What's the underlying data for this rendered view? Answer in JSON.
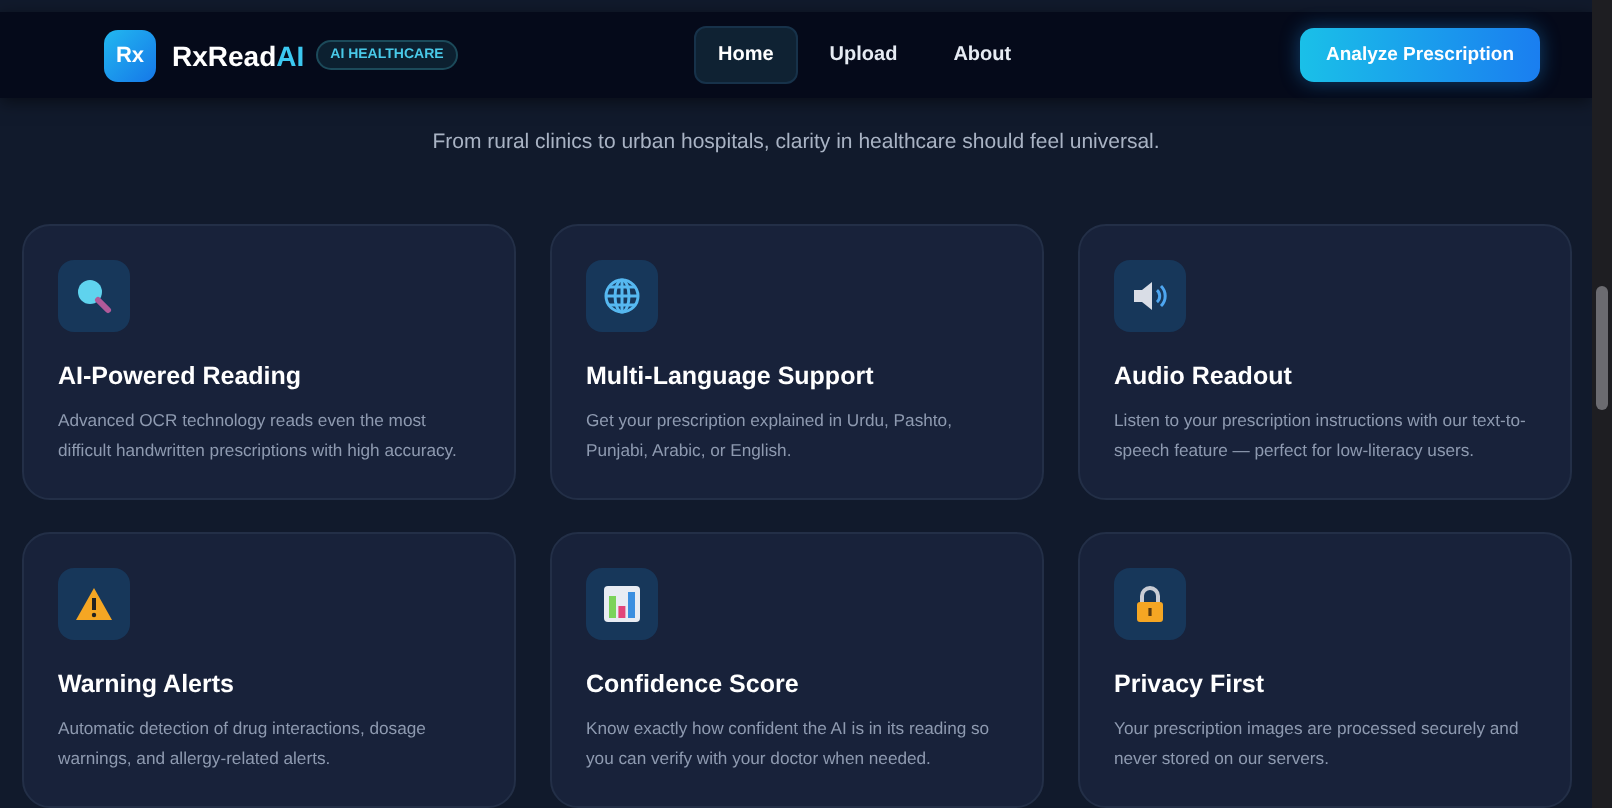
{
  "header": {
    "logo": "Rx",
    "brand": "RxRead",
    "brand_accent": "AI",
    "badge": "AI HEALTHCARE",
    "nav": [
      {
        "label": "Home",
        "selected": true
      },
      {
        "label": "Upload",
        "selected": false
      },
      {
        "label": "About",
        "selected": false
      }
    ],
    "cta": "Analyze Prescription"
  },
  "intro": {
    "subtitle": "From rural clinics to urban hospitals, clarity in healthcare should feel universal."
  },
  "features": [
    {
      "title": "AI-Powered Reading",
      "text": "Advanced OCR technology reads even the most difficult handwritten prescriptions with high accuracy."
    },
    {
      "title": "Multi-Language Support",
      "text": "Get your prescription explained in Urdu, Pashto, Punjabi, Arabic, or English."
    },
    {
      "title": "Audio Readout",
      "text": "Listen to your prescription instructions with our text-to-speech feature — perfect for low-literacy users."
    },
    {
      "title": "Warning Alerts",
      "text": "Automatic detection of drug interactions, dosage warnings, and allergy-related alerts."
    },
    {
      "title": "Confidence Score",
      "text": "Know exactly how confident the AI is in its reading so you can verify with your doctor when needed."
    },
    {
      "title": "Privacy First",
      "text": "Your prescription images are processed securely and never stored on our servers."
    }
  ]
}
